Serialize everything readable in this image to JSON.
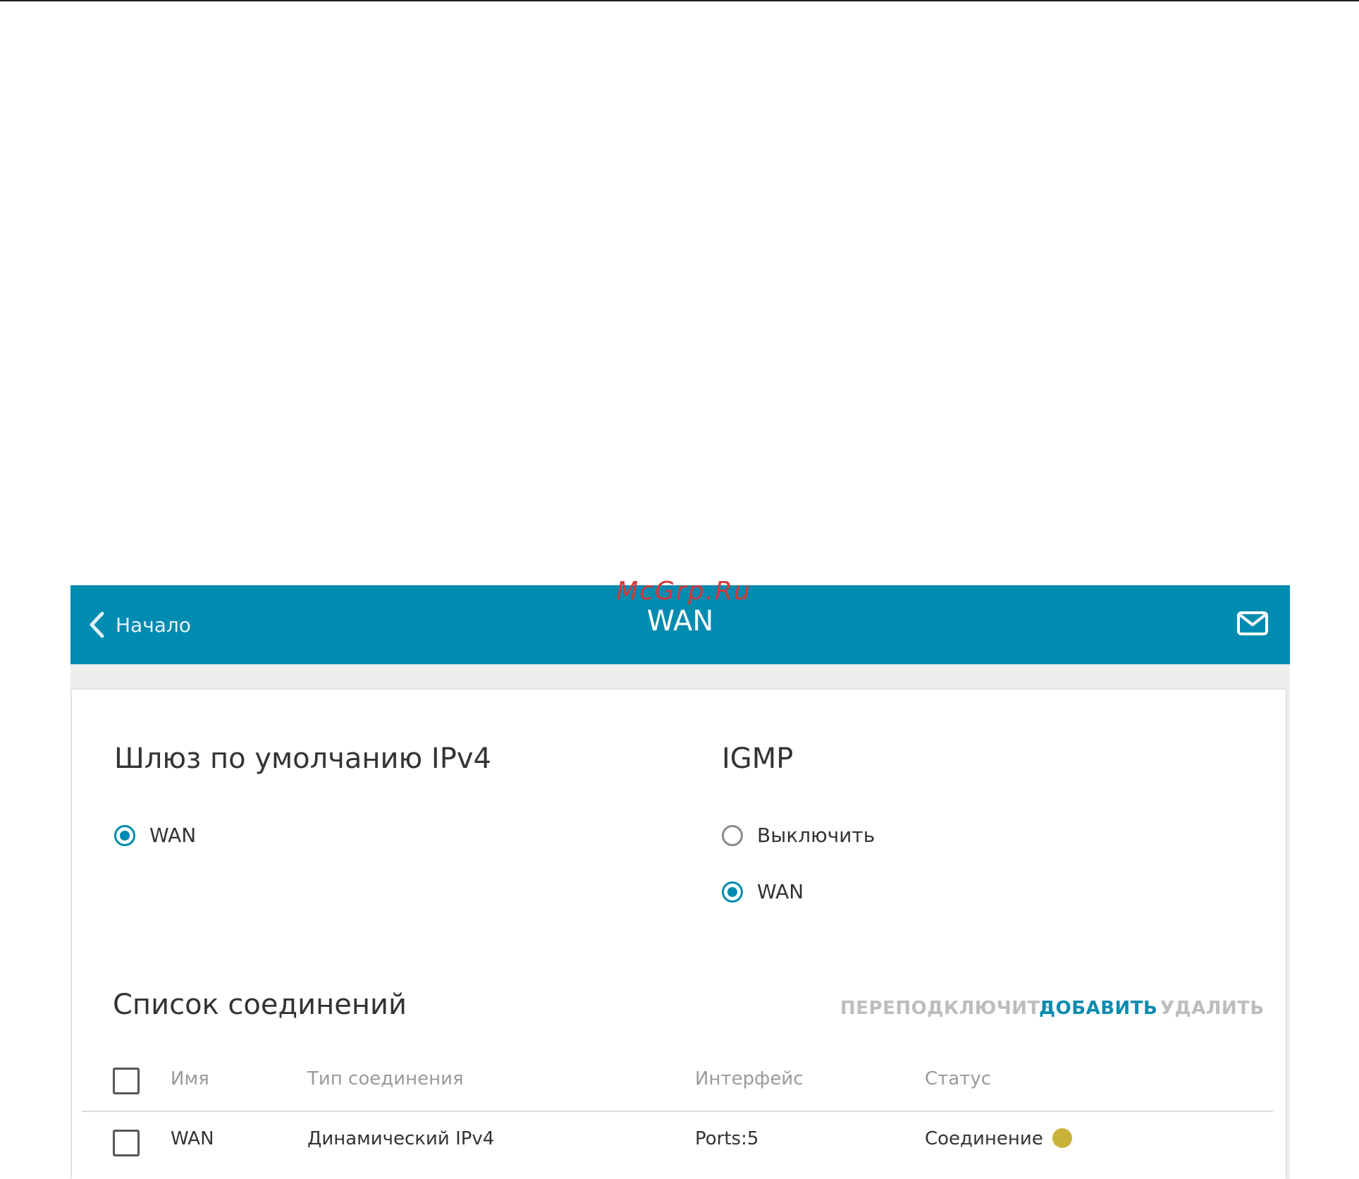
{
  "watermark": "McGrp.Ru",
  "header": {
    "back_label": "Начало",
    "title": "WAN",
    "back_icon": "chevron-left-icon",
    "mail_icon": "envelope-icon"
  },
  "gateway": {
    "title": "Шлюз по умолчанию IPv4",
    "options": [
      {
        "label": "WAN",
        "checked": true
      }
    ]
  },
  "igmp": {
    "title": "IGMP",
    "options": [
      {
        "label": "Выключить",
        "checked": false
      },
      {
        "label": "WAN",
        "checked": true
      }
    ]
  },
  "connections": {
    "title": "Список соединений",
    "actions": {
      "reconnect": "ПЕРЕПОДКЛЮЧИТЬ",
      "add": "ДОБАВИТЬ",
      "delete": "УДАЛИТЬ"
    },
    "columns": {
      "name": "Имя",
      "type": "Тип соединения",
      "interface": "Интерфейс",
      "status": "Статус"
    },
    "rows": [
      {
        "name": "WAN",
        "type": "Динамический IPv4",
        "interface": "Ports:5",
        "status": "Соединение",
        "status_color": "#c9b23a"
      }
    ]
  },
  "colors": {
    "accent": "#008bb0",
    "disabled_action": "#bdbdbd"
  }
}
